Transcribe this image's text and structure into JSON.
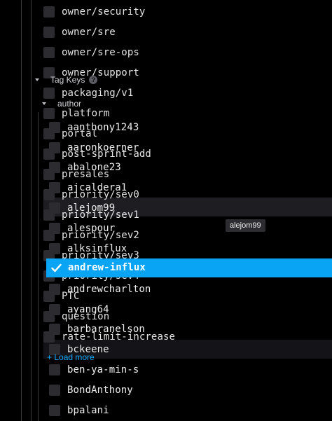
{
  "background_list": [
    {
      "label": "owner/security"
    },
    {
      "label": "owner/sre"
    },
    {
      "label": "owner/sre-ops"
    },
    {
      "label": "owner/support"
    },
    {
      "label": "packaging/v1"
    },
    {
      "label": "platform"
    },
    {
      "label": "portal"
    },
    {
      "label": "post-sprint-add"
    },
    {
      "label": "presales"
    },
    {
      "label": "priority/sev0"
    },
    {
      "label": "priority/sev1"
    },
    {
      "label": "priority/sev2"
    },
    {
      "label": "priority/sev3"
    },
    {
      "label": "priority/sev4"
    },
    {
      "label": "PTC"
    },
    {
      "label": "question"
    },
    {
      "label": "rate-limit-increase"
    }
  ],
  "tag_keys": {
    "label": "Tag Keys",
    "help": "?"
  },
  "author": {
    "label": "author"
  },
  "author_list": [
    {
      "label": "aanthony1243",
      "checked": false
    },
    {
      "label": "aaronkoerner",
      "checked": false
    },
    {
      "label": "abalone23",
      "checked": false
    },
    {
      "label": "ajcaldera1",
      "checked": false
    },
    {
      "label": "alejom99",
      "checked": false
    },
    {
      "label": "alespour",
      "checked": false
    },
    {
      "label": "alksinflux",
      "checked": false
    },
    {
      "label": "andrew-influx",
      "checked": true
    },
    {
      "label": "andrewcharlton",
      "checked": false
    },
    {
      "label": "ayang64",
      "checked": false
    },
    {
      "label": "barbaranelson",
      "checked": false
    },
    {
      "label": "bckeene",
      "checked": false
    },
    {
      "label": "ben-ya-min-s",
      "checked": false
    },
    {
      "label": "BondAnthony",
      "checked": false
    },
    {
      "label": "bpalani",
      "checked": false
    }
  ],
  "tooltip": {
    "text": "alejom99"
  },
  "load_more": {
    "label": "+ Load more"
  },
  "colors": {
    "accent": "#0aa4f5",
    "background": "#000000",
    "checkbox": "#2b2b30",
    "link": "#10a8ff"
  }
}
